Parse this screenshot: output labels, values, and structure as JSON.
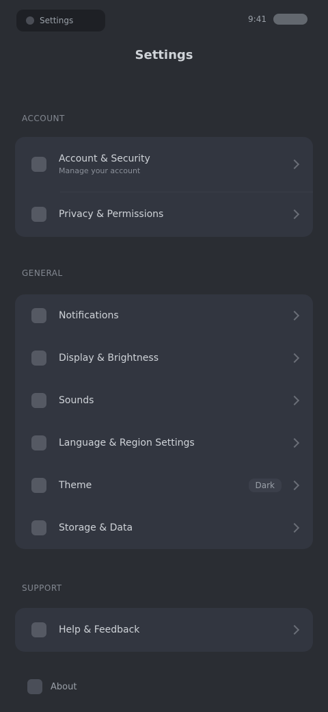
{
  "status": {
    "left_text": "Settings",
    "right_text": "9:41"
  },
  "page": {
    "title": "Settings"
  },
  "sections": {
    "account_label": "ACCOUNT",
    "account_items": [
      {
        "label": "Account & Security",
        "sub": "Manage your account"
      },
      {
        "label": "Privacy & Permissions"
      }
    ],
    "general_label": "GENERAL",
    "general_items": [
      {
        "label": "Notifications"
      },
      {
        "label": "Display & Brightness"
      },
      {
        "label": "Sounds"
      },
      {
        "label": "Language & Region Settings"
      },
      {
        "label": "Theme",
        "value": "Dark"
      },
      {
        "label": "Storage & Data"
      }
    ],
    "support_label": "SUPPORT",
    "support_items": [
      {
        "label": "Help & Feedback"
      }
    ],
    "bottom_label": "About"
  }
}
